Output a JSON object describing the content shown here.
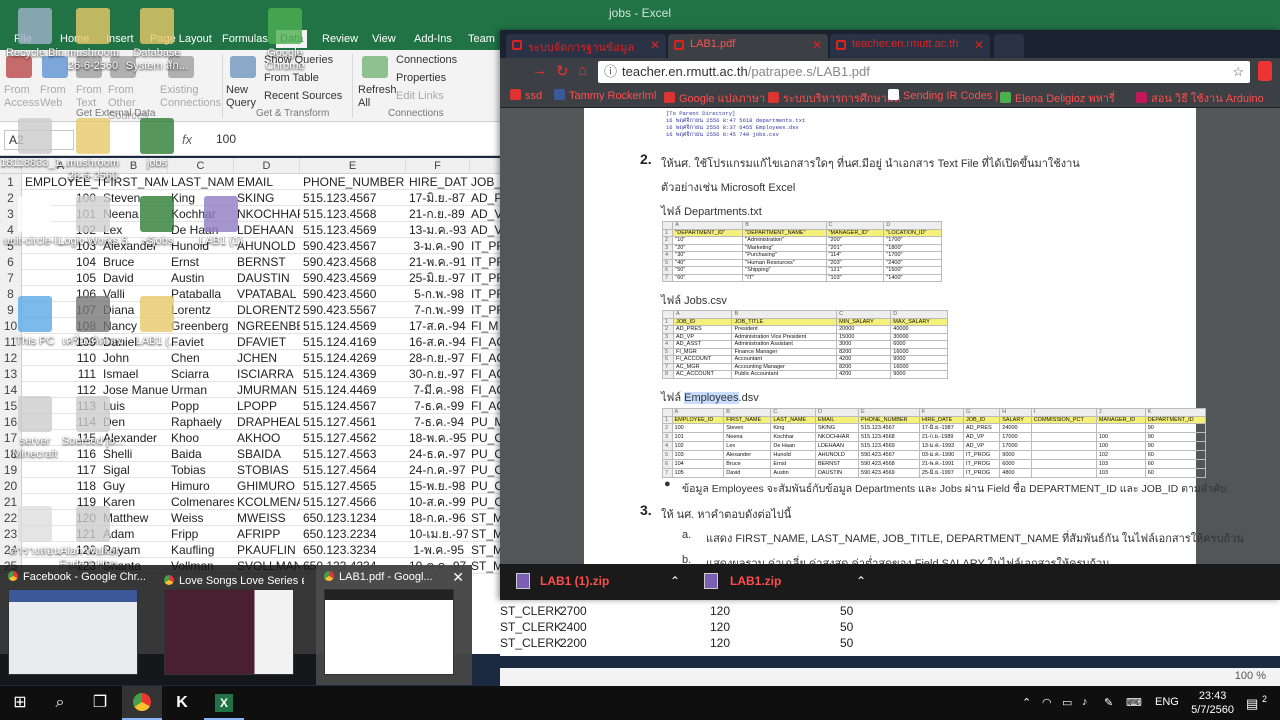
{
  "excel": {
    "window_title": "jobs - Excel",
    "user": "phumin",
    "tabs": [
      "File",
      "Home",
      "Insert",
      "Page Layout",
      "Formulas",
      "Data",
      "Review",
      "View",
      "Add-Ins",
      "Team"
    ],
    "active_tab": "Data",
    "ribbon": {
      "get_external_data": [
        "From Access",
        "From Web",
        "From Text",
        "From Other Sources",
        "Existing Connections"
      ],
      "new_query": "New Query",
      "new_query_items": [
        "Show Queries",
        "From Table",
        "Recent Sources"
      ],
      "get_transform_label": "Get & Transform",
      "refresh_all": "Refresh All",
      "connections_items": [
        "Connections",
        "Properties",
        "Edit Links"
      ],
      "connections_label": "Connections",
      "get_external_label": "Get External Data"
    },
    "name_box": "A2",
    "fx": "fx",
    "formula_value": "100",
    "columns": [
      "A",
      "B",
      "C",
      "D",
      "E",
      "F"
    ],
    "header_row": [
      "EMPLOYEE_ID",
      "FIRST_NAME",
      "LAST_NAME",
      "EMAIL",
      "PHONE_NUMBER",
      "HIRE_DATE",
      "JOB_"
    ],
    "rows": [
      [
        "100",
        "Steven",
        "King",
        "SKING",
        "515.123.4567",
        "17-มิ.ย.-87",
        "AD_P"
      ],
      [
        "101",
        "Neena",
        "Kochhar",
        "NKOCHHAR",
        "515.123.4568",
        "21-ก.ย.-89",
        "AD_V"
      ],
      [
        "102",
        "Lex",
        "De Haan",
        "LDEHAAN",
        "515.123.4569",
        "13-ม.ค.-93",
        "AD_V"
      ],
      [
        "103",
        "Alexander",
        "Hunold",
        "AHUNOLD",
        "590.423.4567",
        "3-ม.ค.-90",
        "IT_PF"
      ],
      [
        "104",
        "Bruce",
        "Ernst",
        "BERNST",
        "590.423.4568",
        "21-พ.ค.-91",
        "IT_PF"
      ],
      [
        "105",
        "David",
        "Austin",
        "DAUSTIN",
        "590.423.4569",
        "25-มิ.ย.-97",
        "IT_PF"
      ],
      [
        "106",
        "Valli",
        "Pataballa",
        "VPATABAL",
        "590.423.4560",
        "5-ก.พ.-98",
        "IT_PF"
      ],
      [
        "107",
        "Diana",
        "Lorentz",
        "DLORENTZ",
        "590.423.5567",
        "7-ก.พ.-99",
        "IT_PF"
      ],
      [
        "108",
        "Nancy",
        "Greenberg",
        "NGREENBE",
        "515.124.4569",
        "17-ส.ค.-94",
        "FI_M"
      ],
      [
        "109",
        "Daniel",
        "Faviet",
        "DFAVIET",
        "515.124.4169",
        "16-ส.ค.-94",
        "FI_AC"
      ],
      [
        "110",
        "John",
        "Chen",
        "JCHEN",
        "515.124.4269",
        "28-ก.ย.-97",
        "FI_AC"
      ],
      [
        "111",
        "Ismael",
        "Sciarra",
        "ISCIARRA",
        "515.124.4369",
        "30-ก.ย.-97",
        "FI_AC"
      ],
      [
        "112",
        "Jose Manuel",
        "Urman",
        "JMURMAN",
        "515.124.4469",
        "7-มี.ค.-98",
        "FI_AC"
      ],
      [
        "113",
        "Luis",
        "Popp",
        "LPOPP",
        "515.124.4567",
        "7-ธ.ค.-99",
        "FI_AC"
      ],
      [
        "114",
        "Den",
        "Raphaely",
        "DRAPHEAL",
        "515.127.4561",
        "7-ธ.ค.-94",
        "PU_M"
      ],
      [
        "115",
        "Alexander",
        "Khoo",
        "AKHOO",
        "515.127.4562",
        "18-พ.ค.-95",
        "PU_C"
      ],
      [
        "116",
        "Shelli",
        "Baida",
        "SBAIDA",
        "515.127.4563",
        "24-ธ.ค.-97",
        "PU_C"
      ],
      [
        "117",
        "Sigal",
        "Tobias",
        "STOBIAS",
        "515.127.4564",
        "24-ก.ค.-97",
        "PU_C"
      ],
      [
        "118",
        "Guy",
        "Himuro",
        "GHIMURO",
        "515.127.4565",
        "15-พ.ย.-98",
        "PU_C"
      ],
      [
        "119",
        "Karen",
        "Colmenares",
        "KCOLMENA",
        "515.127.4566",
        "10-ส.ค.-99",
        "PU_C"
      ],
      [
        "120",
        "Matthew",
        "Weiss",
        "MWEISS",
        "650.123.1234",
        "18-ก.ค.-96",
        "ST_M"
      ],
      [
        "121",
        "Adam",
        "Fripp",
        "AFRIPP",
        "650.123.2234",
        "10-เม.ย.-97",
        "ST_M"
      ],
      [
        "122",
        "Payam",
        "Kaufling",
        "PKAUFLIN",
        "650.123.3234",
        "1-พ.ค.-95",
        "ST_M"
      ],
      [
        "123",
        "Shanta",
        "Vollman",
        "SVOLLMAN",
        "650.123.4234",
        "10-ต.ค.-97",
        "ST_M"
      ]
    ],
    "lower_rows": [
      [
        "ST_CLERK",
        "2700",
        "120",
        "50"
      ],
      [
        "ST_CLERK",
        "2400",
        "120",
        "50"
      ],
      [
        "ST_CLERK",
        "2200",
        "120",
        "50"
      ]
    ],
    "zoom": "100 %"
  },
  "chrome": {
    "tabs": [
      {
        "label": "ระบบจัดการฐานข้อมูล",
        "active": false
      },
      {
        "label": "LAB1.pdf",
        "active": true
      },
      {
        "label": "teacher.en.rmutt.ac.th",
        "active": false
      }
    ],
    "url_host": "teacher.en.rmutt.ac.th",
    "url_path": "/patrapee.s/LAB1.pdf",
    "bookmarks": [
      "ssd",
      "Tammy Rockerlml",
      "Google แปลภาษา",
      "ระบบบริหารการศึกษาแล",
      "Sending IR Codes | U",
      "Elena Deligioz พหารี่",
      "สอน วิธี ใช้งาน Arduino"
    ],
    "downloads": [
      "LAB1 (1).zip",
      "LAB1.zip"
    ]
  },
  "pdf": {
    "dir_lines": [
      "[To Parent Directory]",
      "16 พฤศจิกายน 2556    8:47        5618 departments.txt",
      "16 พฤศจิกายน 2556    8:37        6455 Employees.dsv",
      "16 พฤศจิกายน 2556    8:45         749 jobs.csv"
    ],
    "item2_num": "2.",
    "item2_text": "ให้นศ. ใช้โปรแกรมแก้ไขเอกสารใดๆ ที่นศ.มีอยู่ นำเอกสาร Text File ที่ได้เปิดขึ้นมาใช้งาน",
    "item2_example": "ตัวอย่างเช่น Microsoft Excel",
    "file_dep": "ไฟล์ Departments.txt",
    "file_jobs": "ไฟล์ Jobs.csv",
    "file_emp_pre": "ไฟล์ ",
    "file_emp_hl": "Employees",
    "file_emp_post": ".dsv",
    "bullet_text": "ข้อมูล Employees จะสัมพันธ์กับข้อมูล Departments และ Jobs ผ่าน Field ชื่อ DEPARTMENT_ID และ JOB_ID ตามลำดับ",
    "item3_num": "3.",
    "item3_text": "ให้ นศ. หาคำตอบดังต่อไปนี้",
    "sub_a": "a.",
    "sub_a_text": "แสดง FIRST_NAME, LAST_NAME, JOB_TITLE, DEPARTMENT_NAME ที่สัมพันธ์กัน ในไฟล์เอกสารให้ครบถ้วน",
    "sub_b": "b.",
    "sub_b_text": "แสดงผลรวม ค่าเฉลี่ย ค่าสูงสุด ค่าต่ำสุดของ Field SALARY ในไฟล์เอกสารให้ครบถ้วน",
    "dep_table": {
      "cols": [
        "",
        "A",
        "B",
        "C",
        "D"
      ],
      "rows": [
        [
          "1",
          "\"DEPARTMENT_ID\"",
          "\"DEPARTMENT_NAME\"",
          "\"MANAGER_ID\"",
          "\"LOCATION_ID\""
        ],
        [
          "2",
          "\"10\"",
          "\"Administration\"",
          "\"200\"",
          "\"1700\""
        ],
        [
          "3",
          "\"20\"",
          "\"Marketing\"",
          "\"201\"",
          "\"1800\""
        ],
        [
          "4",
          "\"30\"",
          "\"Purchasing\"",
          "\"114\"",
          "\"1700\""
        ],
        [
          "5",
          "\"40\"",
          "\"Human Resources\"",
          "\"203\"",
          "\"2400\""
        ],
        [
          "6",
          "\"50\"",
          "\"Shipping\"",
          "\"121\"",
          "\"1500\""
        ],
        [
          "7",
          "\"60\"",
          "\"IT\"",
          "\"103\"",
          "\"1400\""
        ]
      ]
    },
    "jobs_table": {
      "cols": [
        "",
        "A",
        "B",
        "C",
        "D"
      ],
      "rows": [
        [
          "1",
          "JOB_ID",
          "JOB_TITLE",
          "MIN_SALARY",
          "MAX_SALARY"
        ],
        [
          "2",
          "AD_PRES",
          "President",
          "20000",
          "40000"
        ],
        [
          "3",
          "AD_VP",
          "Administration Vice President",
          "15000",
          "30000"
        ],
        [
          "4",
          "AD_ASST",
          "Administration Assistant",
          "3000",
          "6000"
        ],
        [
          "5",
          "FI_MGR",
          "Finance Manager",
          "8200",
          "16000"
        ],
        [
          "6",
          "FI_ACCOUNT",
          "Accountant",
          "4200",
          "9000"
        ],
        [
          "7",
          "AC_MGR",
          "Accounting Manager",
          "8200",
          "16000"
        ],
        [
          "8",
          "AC_ACCOUNT",
          "Public Accountant",
          "4200",
          "9000"
        ]
      ]
    },
    "emp_table": {
      "cols": [
        "",
        "A",
        "B",
        "C",
        "D",
        "E",
        "F",
        "G",
        "H",
        "I",
        "J",
        "K"
      ],
      "rows": [
        [
          "1",
          "EMPLOYEE_ID",
          "FIRST_NAME",
          "LAST_NAME",
          "EMAIL",
          "PHONE_NUMBER",
          "HIRE_DATE",
          "JOB_ID",
          "SALARY",
          "COMMISSION_PCT",
          "MANAGER_ID",
          "DEPARTMENT_ID"
        ],
        [
          "2",
          "100",
          "Steven",
          "King",
          "SKING",
          "515.123.4567",
          "17-มิ.ย.-1987",
          "AD_PRES",
          "24000",
          "",
          "",
          "90"
        ],
        [
          "3",
          "101",
          "Neena",
          "Kochhar",
          "NKOCHHAR",
          "515.123.4568",
          "21-ก.ย.-1989",
          "AD_VP",
          "17000",
          "",
          "100",
          "90"
        ],
        [
          "4",
          "102",
          "Lex",
          "De Haan",
          "LDEHAAN",
          "515.123.4569",
          "13-ม.ค.-1993",
          "AD_VP",
          "17000",
          "",
          "100",
          "90"
        ],
        [
          "5",
          "103",
          "Alexander",
          "Hunold",
          "AHUNOLD",
          "590.423.4567",
          "03-ม.ค.-1990",
          "IT_PROG",
          "9000",
          "",
          "102",
          "60"
        ],
        [
          "6",
          "104",
          "Bruce",
          "Ernst",
          "BERNST",
          "590.423.4568",
          "21-พ.ค.-1991",
          "IT_PROG",
          "6000",
          "",
          "103",
          "60"
        ],
        [
          "7",
          "105",
          "David",
          "Austin",
          "DAUSTIN",
          "590.423.4569",
          "25-มิ.ย.-1997",
          "IT_PROG",
          "4800",
          "",
          "103",
          "60"
        ]
      ]
    }
  },
  "desktop_icons": [
    {
      "label": "Recycle Bin",
      "color": "#9fb3c8"
    },
    {
      "label": "mushroom 26-6-2560",
      "color": "#e8c86a"
    },
    {
      "label": "Database System สัก...",
      "color": "#e8c86a"
    },
    {
      "label": "Google Chrome",
      "color": "#4caf50"
    },
    {
      "label": "18118833_1...",
      "color": "#c9c9c9"
    },
    {
      "label": "mushroom 28-5-2560",
      "color": "#e8c86a"
    },
    {
      "label": "jobs",
      "color": "#2e7d32"
    },
    {
      "label": "unit-circle-l...",
      "color": "#ffffff"
    },
    {
      "label": "Logic Works 5",
      "color": "#cfcfcf"
    },
    {
      "label": "~$jobs",
      "color": "#2e7d32"
    },
    {
      "label": "LAB1 (1)",
      "color": "#8e7cc3"
    },
    {
      "label": "This PC",
      "color": "#5aa9e6"
    },
    {
      "label": "เครื่องคิดเลข",
      "color": "#777777"
    },
    {
      "label": "LAB1 (...",
      "color": "#e8c86a"
    },
    {
      "label": "server Minecraft",
      "color": "#cccccc"
    },
    {
      "label": "Sourced [o...",
      "color": "#cccccc"
    },
    {
      "label": "ตารางสอน",
      "color": "#dddddd"
    },
    {
      "label": "Alan Walker - Fade 1 Hou...",
      "color": "#cccccc"
    }
  ],
  "thumbnails": [
    {
      "caption": "Facebook - Google Chr...",
      "selected": false
    },
    {
      "caption": "Love Songs Love Series ตอน สุขา...",
      "selected": false
    },
    {
      "caption": "LAB1.pdf - Googl...",
      "selected": true
    }
  ],
  "taskbar": {
    "lang": "ENG",
    "time": "23:43",
    "date": "5/7/2560",
    "notif_count": "2"
  }
}
